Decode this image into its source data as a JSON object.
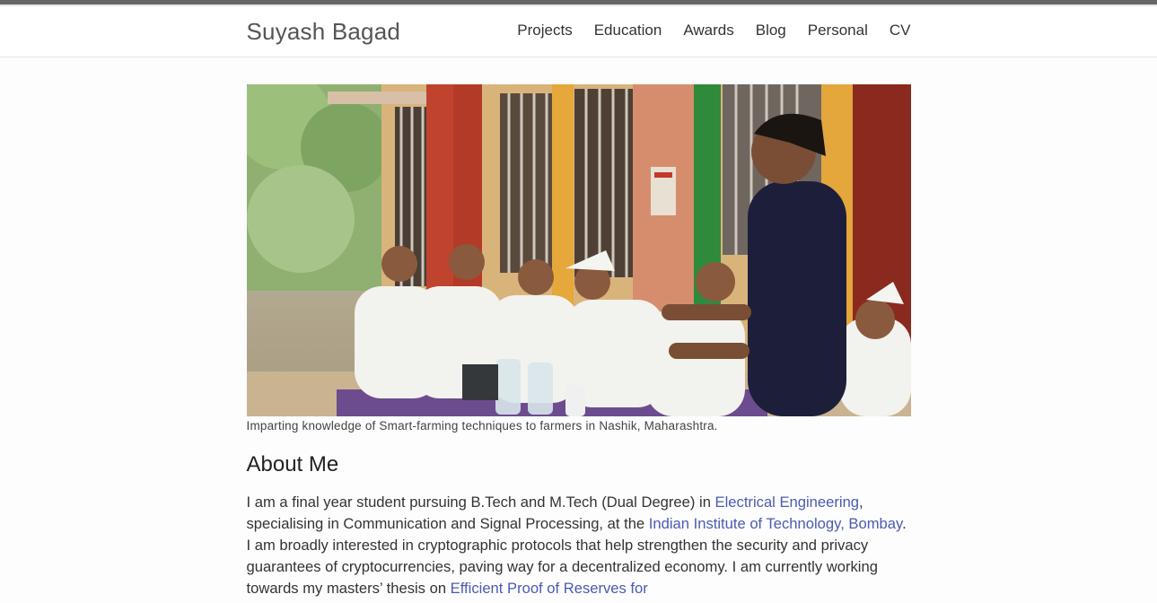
{
  "header": {
    "site_title": "Suyash Bagad",
    "nav": [
      "Projects",
      "Education",
      "Awards",
      "Blog",
      "Personal",
      "CV"
    ]
  },
  "hero": {
    "caption": "Imparting knowledge of Smart-farming techniques to farmers in Nashik, Maharashtra."
  },
  "about": {
    "heading": "About Me",
    "t1": "I am a final year student pursuing B.Tech and M.Tech (Dual Degree) in ",
    "link1": "Electrical Engineering",
    "t2": ", specialising in Communication and Signal Processing, at the ",
    "link2": "Indian Institute of Technology, Bombay",
    "t3": ". I am broadly interested in cryptographic protocols that help strengthen the security and privacy guarantees of cryptocurrencies, paving way for a decentralized economy. I am currently working towards my masters’ thesis on ",
    "link3": "Efficient Proof of Reserves for"
  }
}
